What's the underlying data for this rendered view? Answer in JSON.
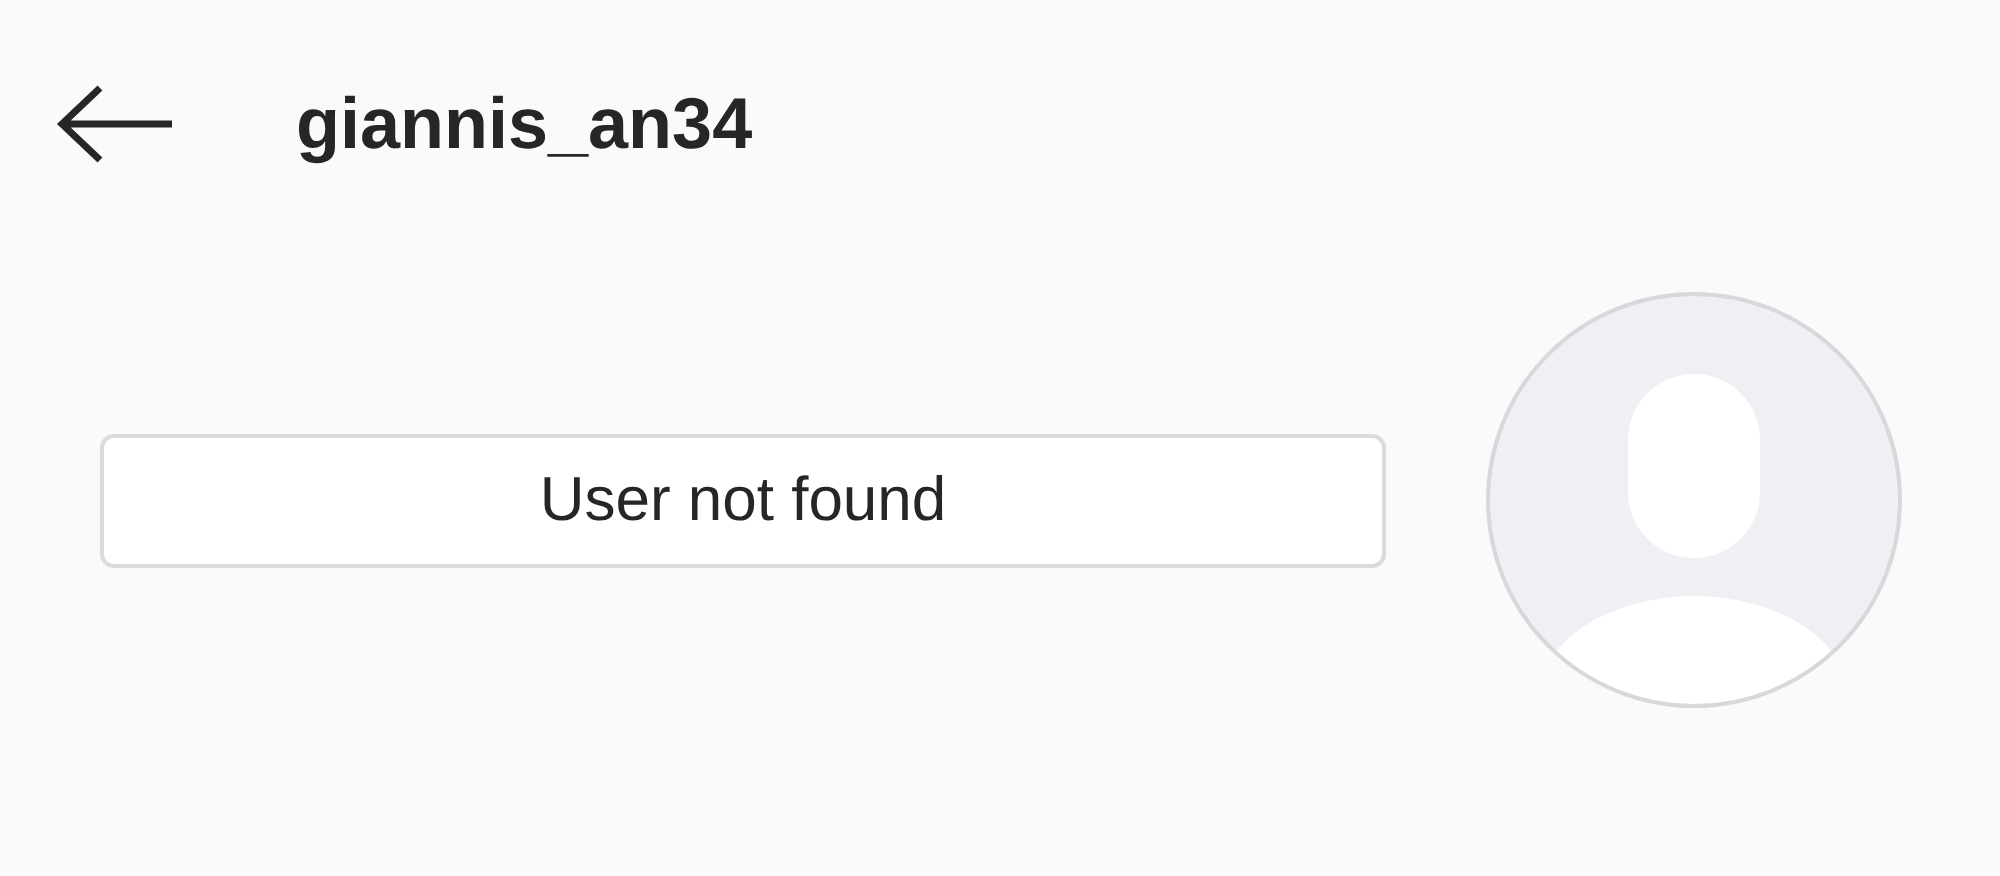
{
  "header": {
    "username": "giannis_an34"
  },
  "profile": {
    "button": "User not found",
    "avatar": {
      "kind": "placeholder"
    }
  }
}
